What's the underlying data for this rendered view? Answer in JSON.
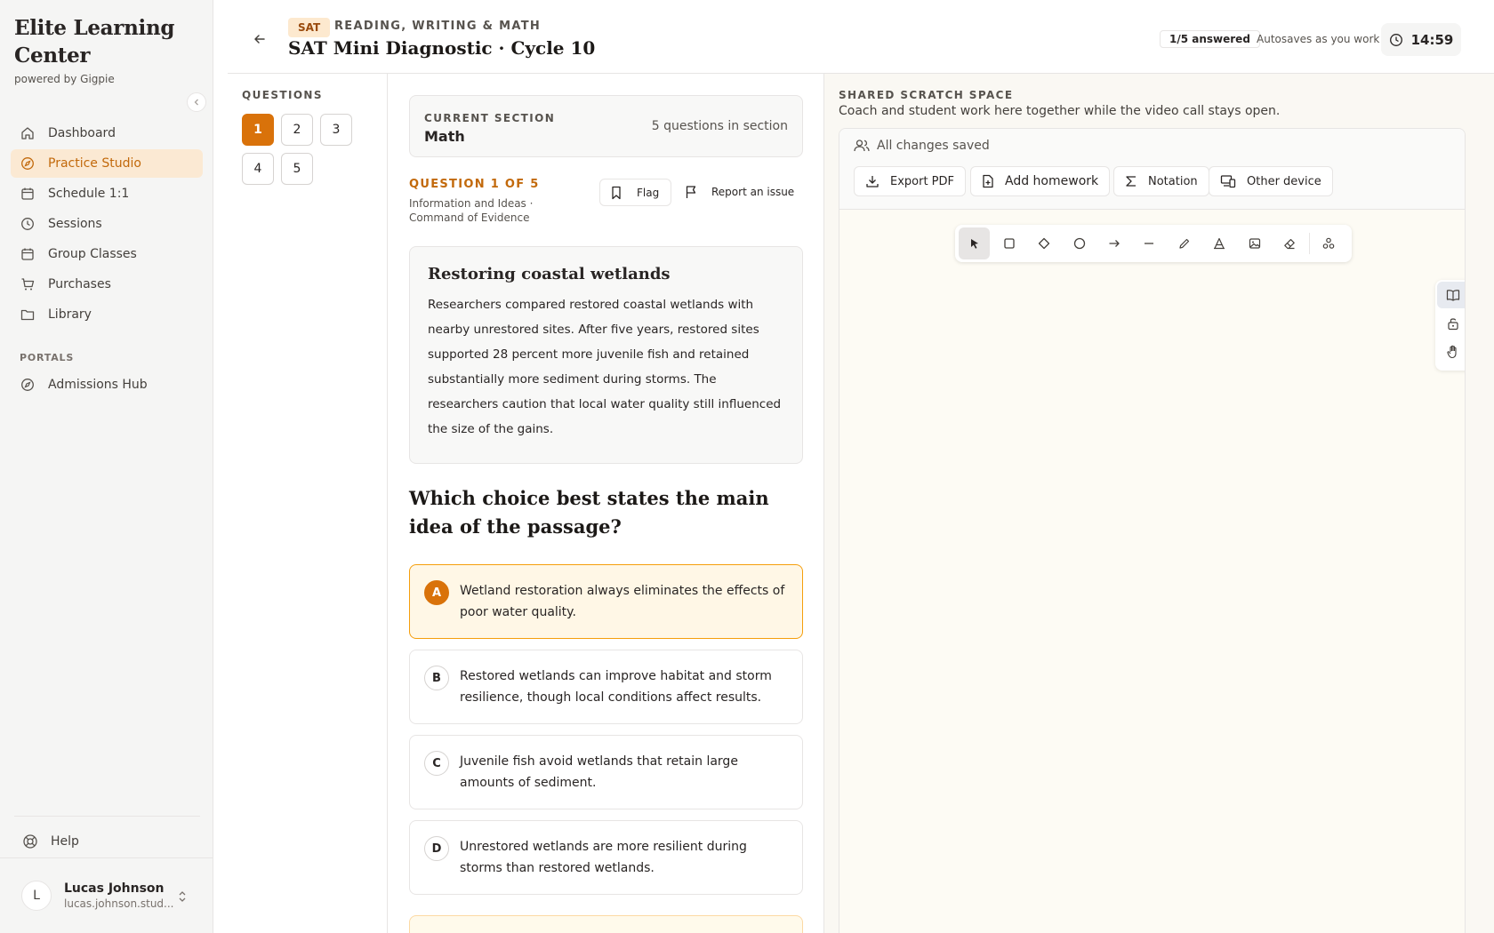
{
  "brand": {
    "title": "Elite Learning Center",
    "subtitle": "powered by Gigpie"
  },
  "sidebar": {
    "items": [
      {
        "label": "Dashboard",
        "icon": "home-icon"
      },
      {
        "label": "Practice Studio",
        "icon": "compass-icon",
        "active": true
      },
      {
        "label": "Schedule 1:1",
        "icon": "calendar-icon"
      },
      {
        "label": "Sessions",
        "icon": "clock-icon"
      },
      {
        "label": "Group Classes",
        "icon": "calendar-icon"
      },
      {
        "label": "Purchases",
        "icon": "cart-icon"
      },
      {
        "label": "Library",
        "icon": "folder-icon"
      }
    ],
    "portals_label": "PORTALS",
    "portals": [
      {
        "label": "Admissions Hub",
        "icon": "compass-icon"
      }
    ],
    "help_label": "Help",
    "user": {
      "initial": "L",
      "name": "Lucas Johnson",
      "email": "lucas.johnson.stud..."
    }
  },
  "header": {
    "badge": "SAT",
    "kicker": "READING, WRITING & MATH",
    "title": "SAT Mini Diagnostic · Cycle 10",
    "answered": "1/5 answered",
    "autosave": "Autosaves as you work",
    "timer": "14:59"
  },
  "questions_nav": {
    "label": "QUESTIONS",
    "items": [
      "1",
      "2",
      "3",
      "4",
      "5"
    ],
    "active": "1"
  },
  "question": {
    "section_label": "CURRENT SECTION",
    "section_value": "Math",
    "section_count": "5 questions in section",
    "number_label": "QUESTION 1 OF 5",
    "meta": "Information and Ideas · Command of Evidence",
    "flag_label": "Flag",
    "report_label": "Report an issue",
    "passage_title": "Restoring coastal wetlands",
    "passage_body": "Researchers compared restored coastal wetlands with nearby unrestored sites. After five years, restored sites supported 28 percent more juvenile fish and retained substantially more sediment during storms. The researchers caution that local water quality still influenced the size of the gains.",
    "prompt": "Which choice best states the main idea of the passage?",
    "choices": [
      {
        "letter": "A",
        "text": "Wetland restoration always eliminates the effects of poor water quality.",
        "selected": true
      },
      {
        "letter": "B",
        "text": "Restored wetlands can improve habitat and storm resilience, though local conditions affect results."
      },
      {
        "letter": "C",
        "text": "Juvenile fish avoid wetlands that retain large amounts of sediment."
      },
      {
        "letter": "D",
        "text": "Unrestored wetlands are more resilient during storms than restored wetlands."
      }
    ]
  },
  "scratch": {
    "label": "SHARED SCRATCH SPACE",
    "subtitle": "Coach and student work here together while the video call stays open.",
    "saved": "All changes saved",
    "buttons": {
      "export": "Export PDF",
      "homework": "Add homework",
      "notation": "Notation",
      "device": "Other device"
    },
    "tools": [
      "select-icon",
      "rectangle-icon",
      "diamond-icon",
      "ellipse-icon",
      "arrow-icon",
      "line-icon",
      "pencil-icon",
      "text-icon",
      "image-icon",
      "eraser-icon",
      "shapes-library-icon"
    ],
    "rail": [
      "book-icon",
      "lock-icon",
      "hand-icon"
    ]
  },
  "colors": {
    "accent": "#d9720a",
    "accent_soft": "#fbe9d3",
    "selected_bg": "#fff7e6",
    "selected_border": "#f59e0b"
  }
}
